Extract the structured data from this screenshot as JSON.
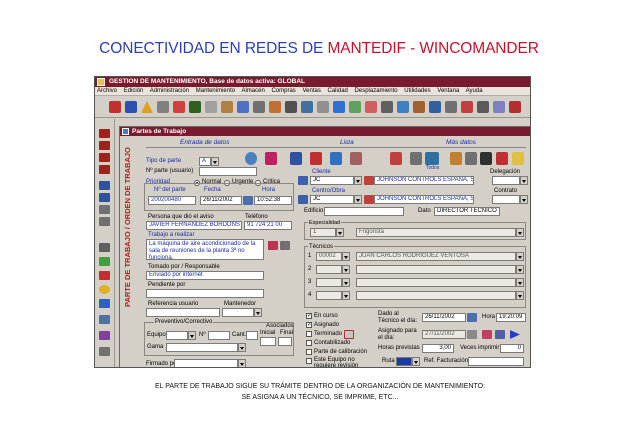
{
  "slide": {
    "title_part1": "CONECTIVIDAD EN REDES DE ",
    "title_part2": "MANTEDIF - WINCOMANDER",
    "caption_line1": "EL PARTE DE TRABAJO SIGUE SU TRÁMITE DENTRO DE LA ORGANIZACIÓN DE MANTENIMIENTO:",
    "caption_line2": "SE ASIGNA A UN TÉCNICO, SE IMPRIME, ETC..."
  },
  "app": {
    "title": "GESTION DE MANTENIMIENTO, Base de datos activa: GLOBAL",
    "menu": [
      "Archivo",
      "Edición",
      "Administración",
      "Mantenimiento",
      "Almacén",
      "Compras",
      "Ventas",
      "Calidad",
      "Desplazamiento",
      "Utilidades",
      "Ventana",
      "Ayuda"
    ]
  },
  "child": {
    "title": "Partes de Trabajo",
    "vertical_title": "PARTE DE TRABAJO / ORDEN DE TRABAJO",
    "tabs": [
      "Entrada de datos",
      "Lista",
      "Más datos"
    ],
    "toolbar_badge": "Todos"
  },
  "form": {
    "tipo_label": "Tipo de parte",
    "tipo_value": "A",
    "nparte_label": "Nº parte (usuario)",
    "prioridad_label": "Prioridad",
    "prioridad_options": [
      "Normal",
      "Urgente",
      "Critica"
    ],
    "nparte2_label": "Nº del parte",
    "fecha_label": "Fecha",
    "hora_label": "Hora",
    "nparte_value": "200200480",
    "fecha_value": "26/11/2002",
    "hora_value": "10:52:38",
    "persona_label": "Persona que dió el aviso",
    "telefono_label": "Teléfono",
    "persona_value": "JAVIER FERNANDEZ BORDONS",
    "telefono_value": "91 724 21 00",
    "trabajo_label": "Trabajo a realizar",
    "trabajo_value": "La máquina de aire acondicionado de la sala de reuniones de la planta 3ª no funciona.",
    "tomado_label": "Tomado por / Responsable",
    "tomado_value": "Enviado por internet",
    "pendiente_label": "Pendiente por",
    "referencia_label": "Referencia usuario",
    "mantenedor_label": "Mantenedor",
    "preventivo_label": "Preventivo/Correctivo",
    "equipo_label": "Equipo",
    "n_label": "Nº",
    "cant_label": "Cant.",
    "asociados_label": "Asociados",
    "inicial_label": "Inicial",
    "final_label": "Final",
    "gama_label": "Gama",
    "firmado_label": "Firmado por",
    "cliente_label": "Cliente",
    "delegacion_label": "Delegación",
    "cliente_code": "JC",
    "cliente_name": "JOHNSON CONTROLS ESPAÑA, S.L.",
    "centro_label": "Centro/Obra",
    "contrato_label": "Contrato",
    "centro_code": "JC",
    "centro_name": "JOHNSON CONTROLS ESPAÑA, S.L.",
    "edificio_label": "Edificio",
    "dato_label": "Dato",
    "dato_value": "DIRECTOR TECNICO",
    "especialidad_label": "Especialidad",
    "especialidad_code": "1",
    "especialidad_name": "Frigorista",
    "tecnicos_label": "Técnicos",
    "tecnicos": [
      {
        "n": "1",
        "code": "00002",
        "name": "JUAN CARLOS RODRIGUEZ VENTOSA"
      },
      {
        "n": "2",
        "code": "",
        "name": ""
      },
      {
        "n": "3",
        "code": "",
        "name": ""
      },
      {
        "n": "4",
        "code": "",
        "name": ""
      }
    ],
    "estados": [
      {
        "label": "En curso",
        "checked": true
      },
      {
        "label": "Asignado",
        "checked": true
      },
      {
        "label": "Terminado",
        "checked": false
      },
      {
        "label": "Contabilizado",
        "checked": false
      },
      {
        "label": "Parte de calibración",
        "checked": false
      },
      {
        "label": "Este Equipo no requiere revisión",
        "checked": false
      }
    ],
    "dado_label": "Dado al Técnico el día:",
    "dado_fecha": "26/11/2002",
    "dado_hora_label": "Hora",
    "dado_hora": "19:20:09",
    "asignado_label": "Asignado para el día:",
    "asignado_fecha": "27/11/2002",
    "horas_label": "Horas previstas",
    "horas_value": "3,00",
    "veces_label": "Veces imprimir",
    "veces_value": "0",
    "ruta_label": "Ruta",
    "ref_label": "Ref. Facturación"
  },
  "colors": {
    "titlebar": "#7a1a2e",
    "label_blue": "#1a2ca0",
    "slide_blue": "#2a3fb8",
    "slide_red": "#c8102e",
    "vertical_red": "#b02020"
  }
}
